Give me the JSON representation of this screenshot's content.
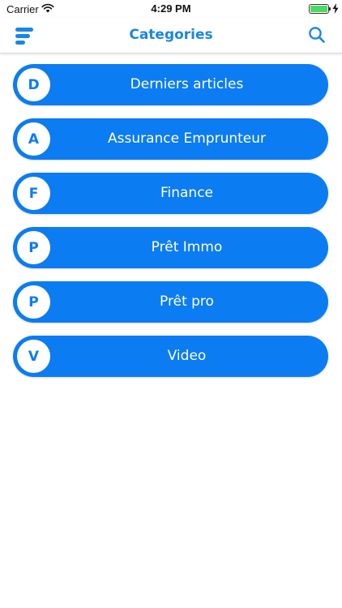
{
  "status_bar": {
    "carrier": "Carrier",
    "time": "4:29 PM",
    "wifi_icon": "wifi-icon",
    "battery_icon": "battery-icon",
    "charge_icon": "charging-bolt-icon",
    "battery_level": 1.0
  },
  "nav_bar": {
    "title": "Categories",
    "menu_icon": "menu-icon",
    "search_icon": "search-icon"
  },
  "colors": {
    "accent": "#0c7cf2",
    "title": "#1a86e6",
    "battery": "#4cd964"
  },
  "categories": [
    {
      "letter": "D",
      "label": "Derniers articles"
    },
    {
      "letter": "A",
      "label": "Assurance Emprunteur"
    },
    {
      "letter": "F",
      "label": "Finance"
    },
    {
      "letter": "P",
      "label": "Prêt Immo"
    },
    {
      "letter": "P",
      "label": "Prêt pro"
    },
    {
      "letter": "V",
      "label": "Video"
    }
  ]
}
